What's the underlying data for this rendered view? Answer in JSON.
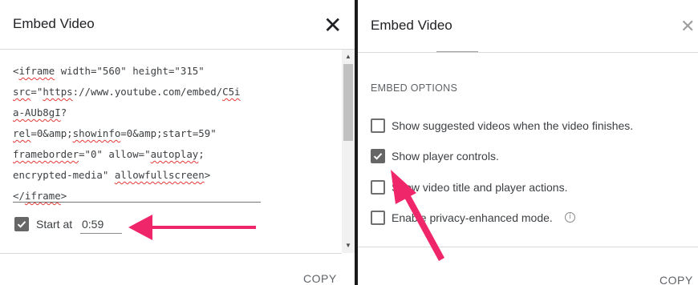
{
  "left_dialog": {
    "title": "Embed Video",
    "code_lines": [
      [
        {
          "t": "<"
        },
        {
          "t": "iframe",
          "sq": true
        },
        {
          "t": " width=\"560\" height=\"315\""
        }
      ],
      [
        {
          "t": "src",
          "sq": true
        },
        {
          "t": "=\""
        },
        {
          "t": "https",
          "sq": true
        },
        {
          "t": "://www.youtube.com/embed/"
        },
        {
          "t": "C5i",
          "sq": true
        }
      ],
      [
        {
          "t": "a-AUb8gI",
          "sq": true
        },
        {
          "t": "?"
        }
      ],
      [
        {
          "t": "rel",
          "sq": true
        },
        {
          "t": "=0&amp;"
        },
        {
          "t": "showinfo",
          "sq": true
        },
        {
          "t": "=0&amp;start=59\""
        }
      ],
      [
        {
          "t": "frameborder",
          "sq": true
        },
        {
          "t": "=\"0\" allow=\""
        },
        {
          "t": "autoplay",
          "sq": true
        },
        {
          "t": ";"
        }
      ],
      [
        {
          "t": "encrypted-media\" "
        },
        {
          "t": "allowfullscreen",
          "sq": true
        },
        {
          "t": ">"
        }
      ],
      [
        {
          "t": "</"
        },
        {
          "t": "iframe",
          "sq": true
        },
        {
          "t": ">"
        }
      ]
    ],
    "start_at_label": "Start at",
    "start_at_value": "0:59",
    "start_at_checked": true,
    "copy_label": "COPY"
  },
  "right_dialog": {
    "title": "Embed Video",
    "section_heading": "EMBED OPTIONS",
    "options": [
      {
        "label": "Show suggested videos when the video finishes.",
        "checked": false
      },
      {
        "label": "Show player controls.",
        "checked": true
      },
      {
        "label": "Show video title and player actions.",
        "checked": false
      },
      {
        "label": "Enable privacy-enhanced mode.",
        "checked": false,
        "info": true
      }
    ],
    "copy_label": "COPY"
  },
  "colors": {
    "annotation_arrow": "#f0266a",
    "checkbox_checked": "#666666"
  },
  "icons": {
    "close": "close-icon",
    "info": "info-icon",
    "check": "checkmark-icon"
  }
}
